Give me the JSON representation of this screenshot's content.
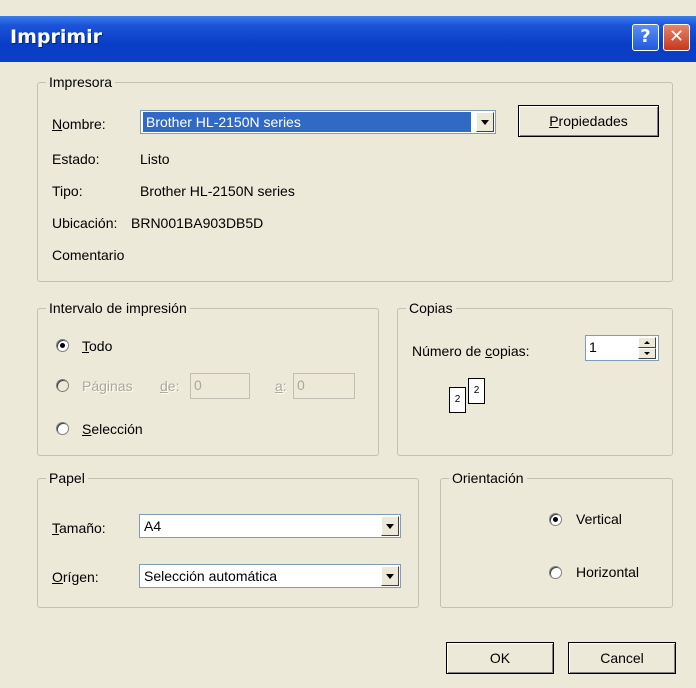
{
  "window": {
    "title": "Imprimir",
    "help_glyph": "?",
    "close_glyph": "✕"
  },
  "printer": {
    "group_label": "Impresora",
    "name_label_first": "N",
    "name_label_rest": "ombre:",
    "name_value": "Brother HL-2150N series",
    "properties_first": "P",
    "properties_rest": "ropiedades",
    "status_label": "Estado:",
    "status_value": "Listo",
    "type_label": "Tipo:",
    "type_value": "Brother HL-2150N series",
    "location_label": "Ubicación:",
    "location_value": "BRN001BA903DB5D",
    "comment_label": "Comentario"
  },
  "range": {
    "group_label": "Intervalo de impresión",
    "all_first": "T",
    "all_rest": "odo",
    "pages_label": "Páginas",
    "from_first": "d",
    "from_rest": "e:",
    "from_value": "0",
    "to_first": "a",
    "to_rest": ":",
    "to_value": "0",
    "selection_first": "S",
    "selection_rest": "elección",
    "selected": "Todo"
  },
  "copies": {
    "group_label": "Copias",
    "count_label_a": "Número de ",
    "count_label_u": "c",
    "count_label_b": "opias:",
    "count_value": "1",
    "collate_page_1": "2",
    "collate_page_2": "2"
  },
  "paper": {
    "group_label": "Papel",
    "size_first": "T",
    "size_rest": "amaño:",
    "size_value": "A4",
    "source_first": "O",
    "source_rest": "rígen:",
    "source_value": "Selección automática"
  },
  "orientation": {
    "group_label": "Orientación",
    "portrait": "Vertical",
    "landscape": "Horizontal",
    "selected": "Vertical"
  },
  "buttons": {
    "ok": "OK",
    "cancel": "Cancel"
  }
}
